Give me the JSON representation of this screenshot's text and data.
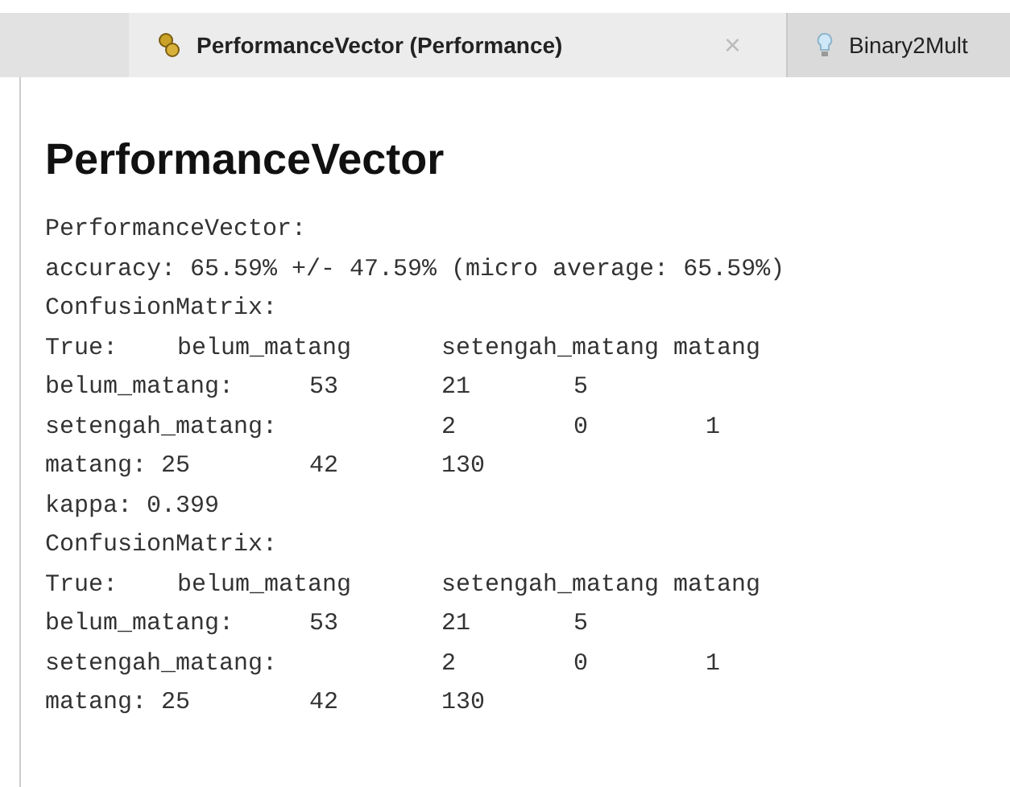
{
  "tabs": [
    {
      "label": "PerformanceVector (Performance)",
      "kind": "performance",
      "selected": true,
      "close_glyph": "×"
    },
    {
      "label": "Binary2Mult",
      "kind": "bulb",
      "selected": false
    }
  ],
  "heading": "PerformanceVector",
  "lines": [
    "PerformanceVector:",
    "accuracy: 65.59% +/- 47.59% (micro average: 65.59%)",
    "ConfusionMatrix:",
    "True:\tbelum_matang\tsetengah_matang matang",
    "belum_matang:\t53\t21\t5",
    "setengah_matang:\t\t2\t0\t1",
    "matang: 25\t42\t130",
    "kappa: 0.399",
    "ConfusionMatrix:",
    "True:\tbelum_matang\tsetengah_matang matang",
    "belum_matang:\t53\t21\t5",
    "setengah_matang:\t\t2\t0\t1",
    "matang: 25\t42\t130"
  ]
}
